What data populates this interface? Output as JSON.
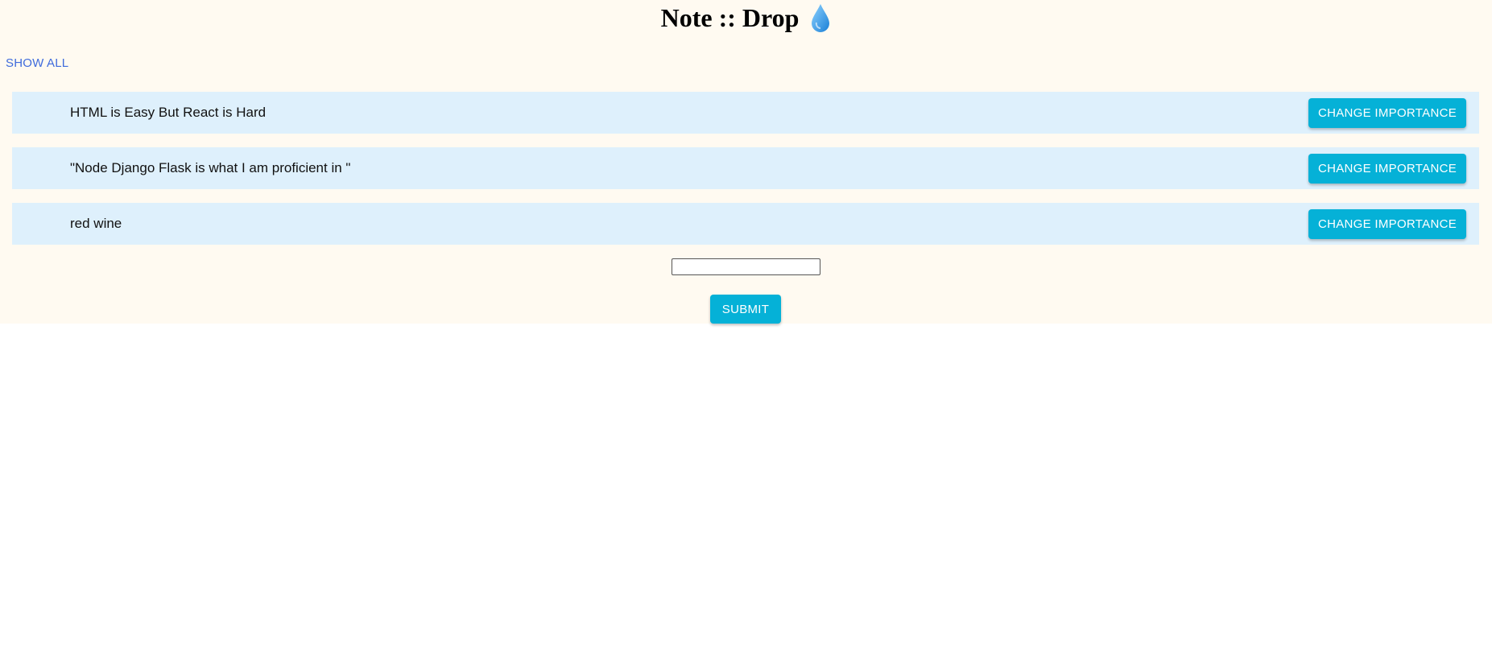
{
  "header": {
    "title": "Note :: Drop",
    "icon": "water-drop-icon"
  },
  "nav": {
    "show_all_label": "SHOW ALL"
  },
  "notes": [
    {
      "text": "HTML is Easy But React is Hard",
      "button_label": "CHANGE IMPORTANCE"
    },
    {
      "text": "\"Node Django Flask is what I am proficient in \"",
      "button_label": "CHANGE IMPORTANCE"
    },
    {
      "text": "red wine",
      "button_label": "CHANGE IMPORTANCE"
    }
  ],
  "form": {
    "input_value": "",
    "submit_label": "SUBMIT"
  },
  "colors": {
    "page_background": "#fffaf1",
    "note_background": "#def0fc",
    "button_background": "#05b1d7",
    "link": "#3f6bdc"
  }
}
